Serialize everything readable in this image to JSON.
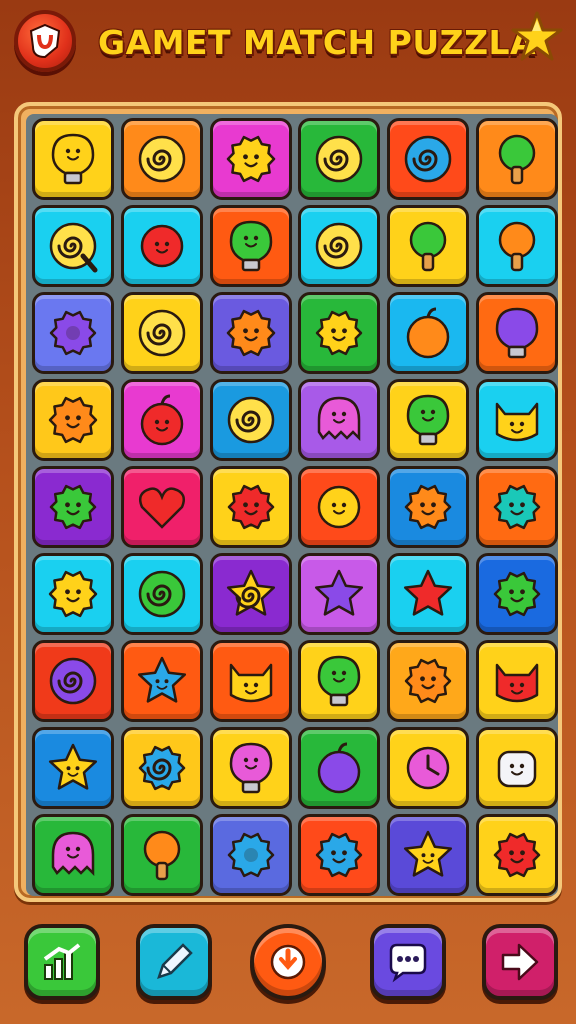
{
  "header": {
    "title": "GAMET MATCH PUZZLA",
    "menu_icon": "shield-swirl-icon",
    "star_icon": "star-icon"
  },
  "board": {
    "rows": [
      [
        {
          "color": "#ffd21a",
          "icon": "lightbulb-icon"
        },
        {
          "color": "#ff8a1a",
          "icon": "number-nine-icon"
        },
        {
          "color": "#e83ad0",
          "icon": "sun-face-icon"
        },
        {
          "color": "#28b83a",
          "icon": "swirl-shield-icon"
        },
        {
          "color": "#ff4a1a",
          "icon": "blue-swirl-icon"
        },
        {
          "color": "#ff8a1a",
          "icon": "green-cactus-icon"
        }
      ],
      [
        {
          "color": "#1ad0f0",
          "icon": "magnifier-swirl-icon"
        },
        {
          "color": "#1ad0f0",
          "icon": "red-lollipop-icon"
        },
        {
          "color": "#ff5a12",
          "icon": "green-bulb-icon"
        },
        {
          "color": "#1ad0f0",
          "icon": "diamond-swirl-icon"
        },
        {
          "color": "#ffd21a",
          "icon": "green-mushroom-icon"
        },
        {
          "color": "#1ad0f0",
          "icon": "orange-tree-icon"
        }
      ],
      [
        {
          "color": "#6a78f0",
          "icon": "purple-gear-icon"
        },
        {
          "color": "#ffd21a",
          "icon": "yellow-cat-swirl-icon"
        },
        {
          "color": "#6a5ae0",
          "icon": "orange-sun-face-icon"
        },
        {
          "color": "#28b83a",
          "icon": "yellow-gear-face-icon"
        },
        {
          "color": "#1ab8f0",
          "icon": "orange-fruit-icon"
        },
        {
          "color": "#ff6a12",
          "icon": "purple-balloon-icon"
        }
      ],
      [
        {
          "color": "#ffc81a",
          "icon": "orange-sun-face-icon"
        },
        {
          "color": "#e83ad0",
          "icon": "red-bomb-face-icon"
        },
        {
          "color": "#1a9ae0",
          "icon": "yellow-swirl-bubble-icon"
        },
        {
          "color": "#a85ae8",
          "icon": "pink-ghost-icon"
        },
        {
          "color": "#ffd21a",
          "icon": "green-bulb-face-icon"
        },
        {
          "color": "#1ad0f0",
          "icon": "yellow-cat-icon"
        }
      ],
      [
        {
          "color": "#8a2ad0",
          "icon": "green-gear-face-icon"
        },
        {
          "color": "#f0206a",
          "icon": "red-heart-icon"
        },
        {
          "color": "#ffd21a",
          "icon": "red-gear-face-icon"
        },
        {
          "color": "#ff4a1a",
          "icon": "yellow-lollipop-face-icon"
        },
        {
          "color": "#1a8ae0",
          "icon": "orange-gear-face-icon"
        },
        {
          "color": "#ff6a12",
          "icon": "teal-gear-face-icon"
        }
      ],
      [
        {
          "color": "#1ad0f0",
          "icon": "yellow-sun-face-icon"
        },
        {
          "color": "#1ad0f0",
          "icon": "green-swirl-blob-icon"
        },
        {
          "color": "#8a2ad0",
          "icon": "yellow-star-swirl-icon"
        },
        {
          "color": "#c85ae8",
          "icon": "purple-star-icon"
        },
        {
          "color": "#1ad0f0",
          "icon": "red-starburst-icon"
        },
        {
          "color": "#1a6ae0",
          "icon": "green-gear-face-icon"
        }
      ],
      [
        {
          "color": "#f03a1a",
          "icon": "purple-spiral-icon"
        },
        {
          "color": "#ff5a12",
          "icon": "blue-star-face-icon"
        },
        {
          "color": "#ff5a12",
          "icon": "robot-cow-icon"
        },
        {
          "color": "#ffd21a",
          "icon": "green-bulb-face-icon"
        },
        {
          "color": "#ffa81a",
          "icon": "orange-gear-face-icon"
        },
        {
          "color": "#ffd21a",
          "icon": "red-cat-face-icon"
        }
      ],
      [
        {
          "color": "#1a8ae0",
          "icon": "yellow-star-face-icon"
        },
        {
          "color": "#ffc81a",
          "icon": "blue-swirl-gear-icon"
        },
        {
          "color": "#ffd21a",
          "icon": "pink-balloon-face-icon"
        },
        {
          "color": "#28b83a",
          "icon": "purple-plum-icon"
        },
        {
          "color": "#ffd21a",
          "icon": "pink-clock-icon"
        },
        {
          "color": "#ffd21a",
          "icon": "white-robot-face-icon"
        }
      ],
      [
        {
          "color": "#28b83a",
          "icon": "pink-ghost-icon"
        },
        {
          "color": "#28b83a",
          "icon": "orange-key-icon"
        },
        {
          "color": "#5a6ae0",
          "icon": "blue-gear-icon"
        },
        {
          "color": "#ff4a1a",
          "icon": "blue-gear-face-icon"
        },
        {
          "color": "#5a4ad8",
          "icon": "yellow-star-face-icon"
        },
        {
          "color": "#ffd21a",
          "icon": "red-gear-face-icon"
        }
      ]
    ]
  },
  "bottom_bar": [
    {
      "icon": "bar-chart-icon",
      "color": "#3ac83a"
    },
    {
      "icon": "pencil-icon",
      "color": "#1ab8d8"
    },
    {
      "icon": "power-icon",
      "color": "#ff5a12"
    },
    {
      "icon": "chat-bubble-icon",
      "color": "#6a4ae0"
    },
    {
      "icon": "arrow-right-icon",
      "color": "#d0206a"
    }
  ]
}
